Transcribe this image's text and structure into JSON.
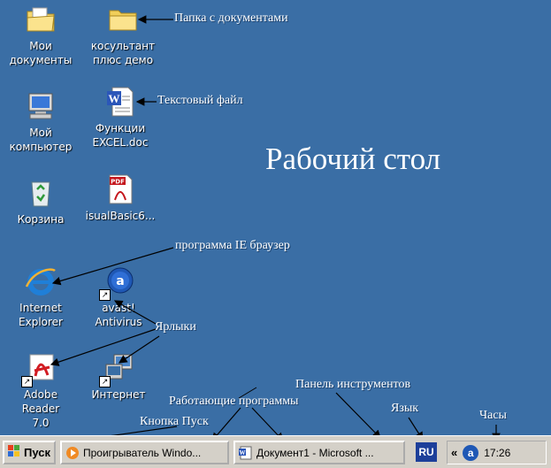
{
  "desktop": {
    "title": "Рабочий стол",
    "icons": [
      {
        "label_line1": "Мои",
        "label_line2": "документы"
      },
      {
        "label_line1": "косультант",
        "label_line2": "плюс демо"
      },
      {
        "label_line1": "Мой",
        "label_line2": "компьютер"
      },
      {
        "label_line1": "Функции",
        "label_line2": "EXCEL.doc"
      },
      {
        "label_line1": "Корзина",
        "label_line2": ""
      },
      {
        "label_line1": "isualBasic6...",
        "label_line2": ""
      },
      {
        "label_line1": "Internet",
        "label_line2": "Explorer"
      },
      {
        "label_line1": "avast!",
        "label_line2": "Antivirus"
      },
      {
        "label_line1": "Adobe Reader",
        "label_line2": "7.0"
      },
      {
        "label_line1": "Интернет",
        "label_line2": ""
      }
    ]
  },
  "annotations": {
    "folder": "Папка с документами",
    "text_file": "Текстовый файл",
    "ie_browser": "программа  IE браузер",
    "shortcuts": "Ярлыки",
    "toolbar": "Панель инструментов",
    "running": "Работающие программы",
    "start": "Кнопка Пуск",
    "language": "Язык",
    "clock": "Часы"
  },
  "taskbar": {
    "start_label": "Пуск",
    "buttons": [
      {
        "label": "Проигрыватель Windo..."
      },
      {
        "label": "Документ1 - Microsoft ..."
      }
    ],
    "language": "RU",
    "tray_chevron": "«",
    "tray_avast": "a",
    "clock": "17:26"
  },
  "colors": {
    "desktop": "#3a6ea5",
    "taskbar": "#d4d0c8"
  }
}
